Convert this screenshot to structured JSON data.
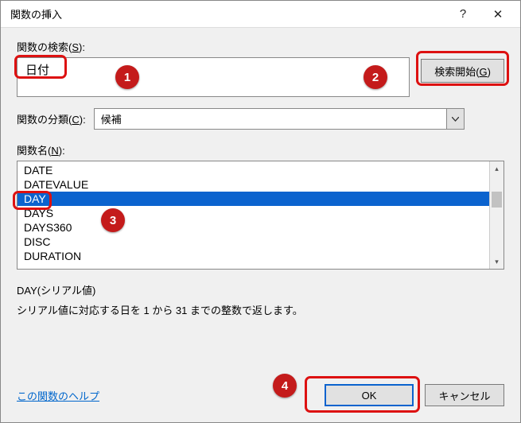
{
  "titlebar": {
    "title": "関数の挿入"
  },
  "search": {
    "label": "関数の検索(",
    "label_key": "S",
    "label_suffix": "):",
    "value": "日付",
    "go_label": "検索開始(",
    "go_key": "G",
    "go_suffix": ")"
  },
  "category": {
    "label": "関数の分類(",
    "label_key": "C",
    "label_suffix": "):",
    "selected": "候補"
  },
  "functions": {
    "label": "関数名(",
    "label_key": "N",
    "label_suffix": "):",
    "items": [
      "DATE",
      "DATEVALUE",
      "DAY",
      "DAYS",
      "DAYS360",
      "DISC",
      "DURATION"
    ],
    "selected_index": 2
  },
  "description": {
    "signature": "DAY(シリアル値)",
    "text": "シリアル値に対応する日を 1 から 31 までの整数で返します。"
  },
  "footer": {
    "help": "この関数のヘルプ",
    "ok": "OK",
    "cancel": "キャンセル"
  },
  "callouts": {
    "c1": "1",
    "c2": "2",
    "c3": "3",
    "c4": "4"
  }
}
